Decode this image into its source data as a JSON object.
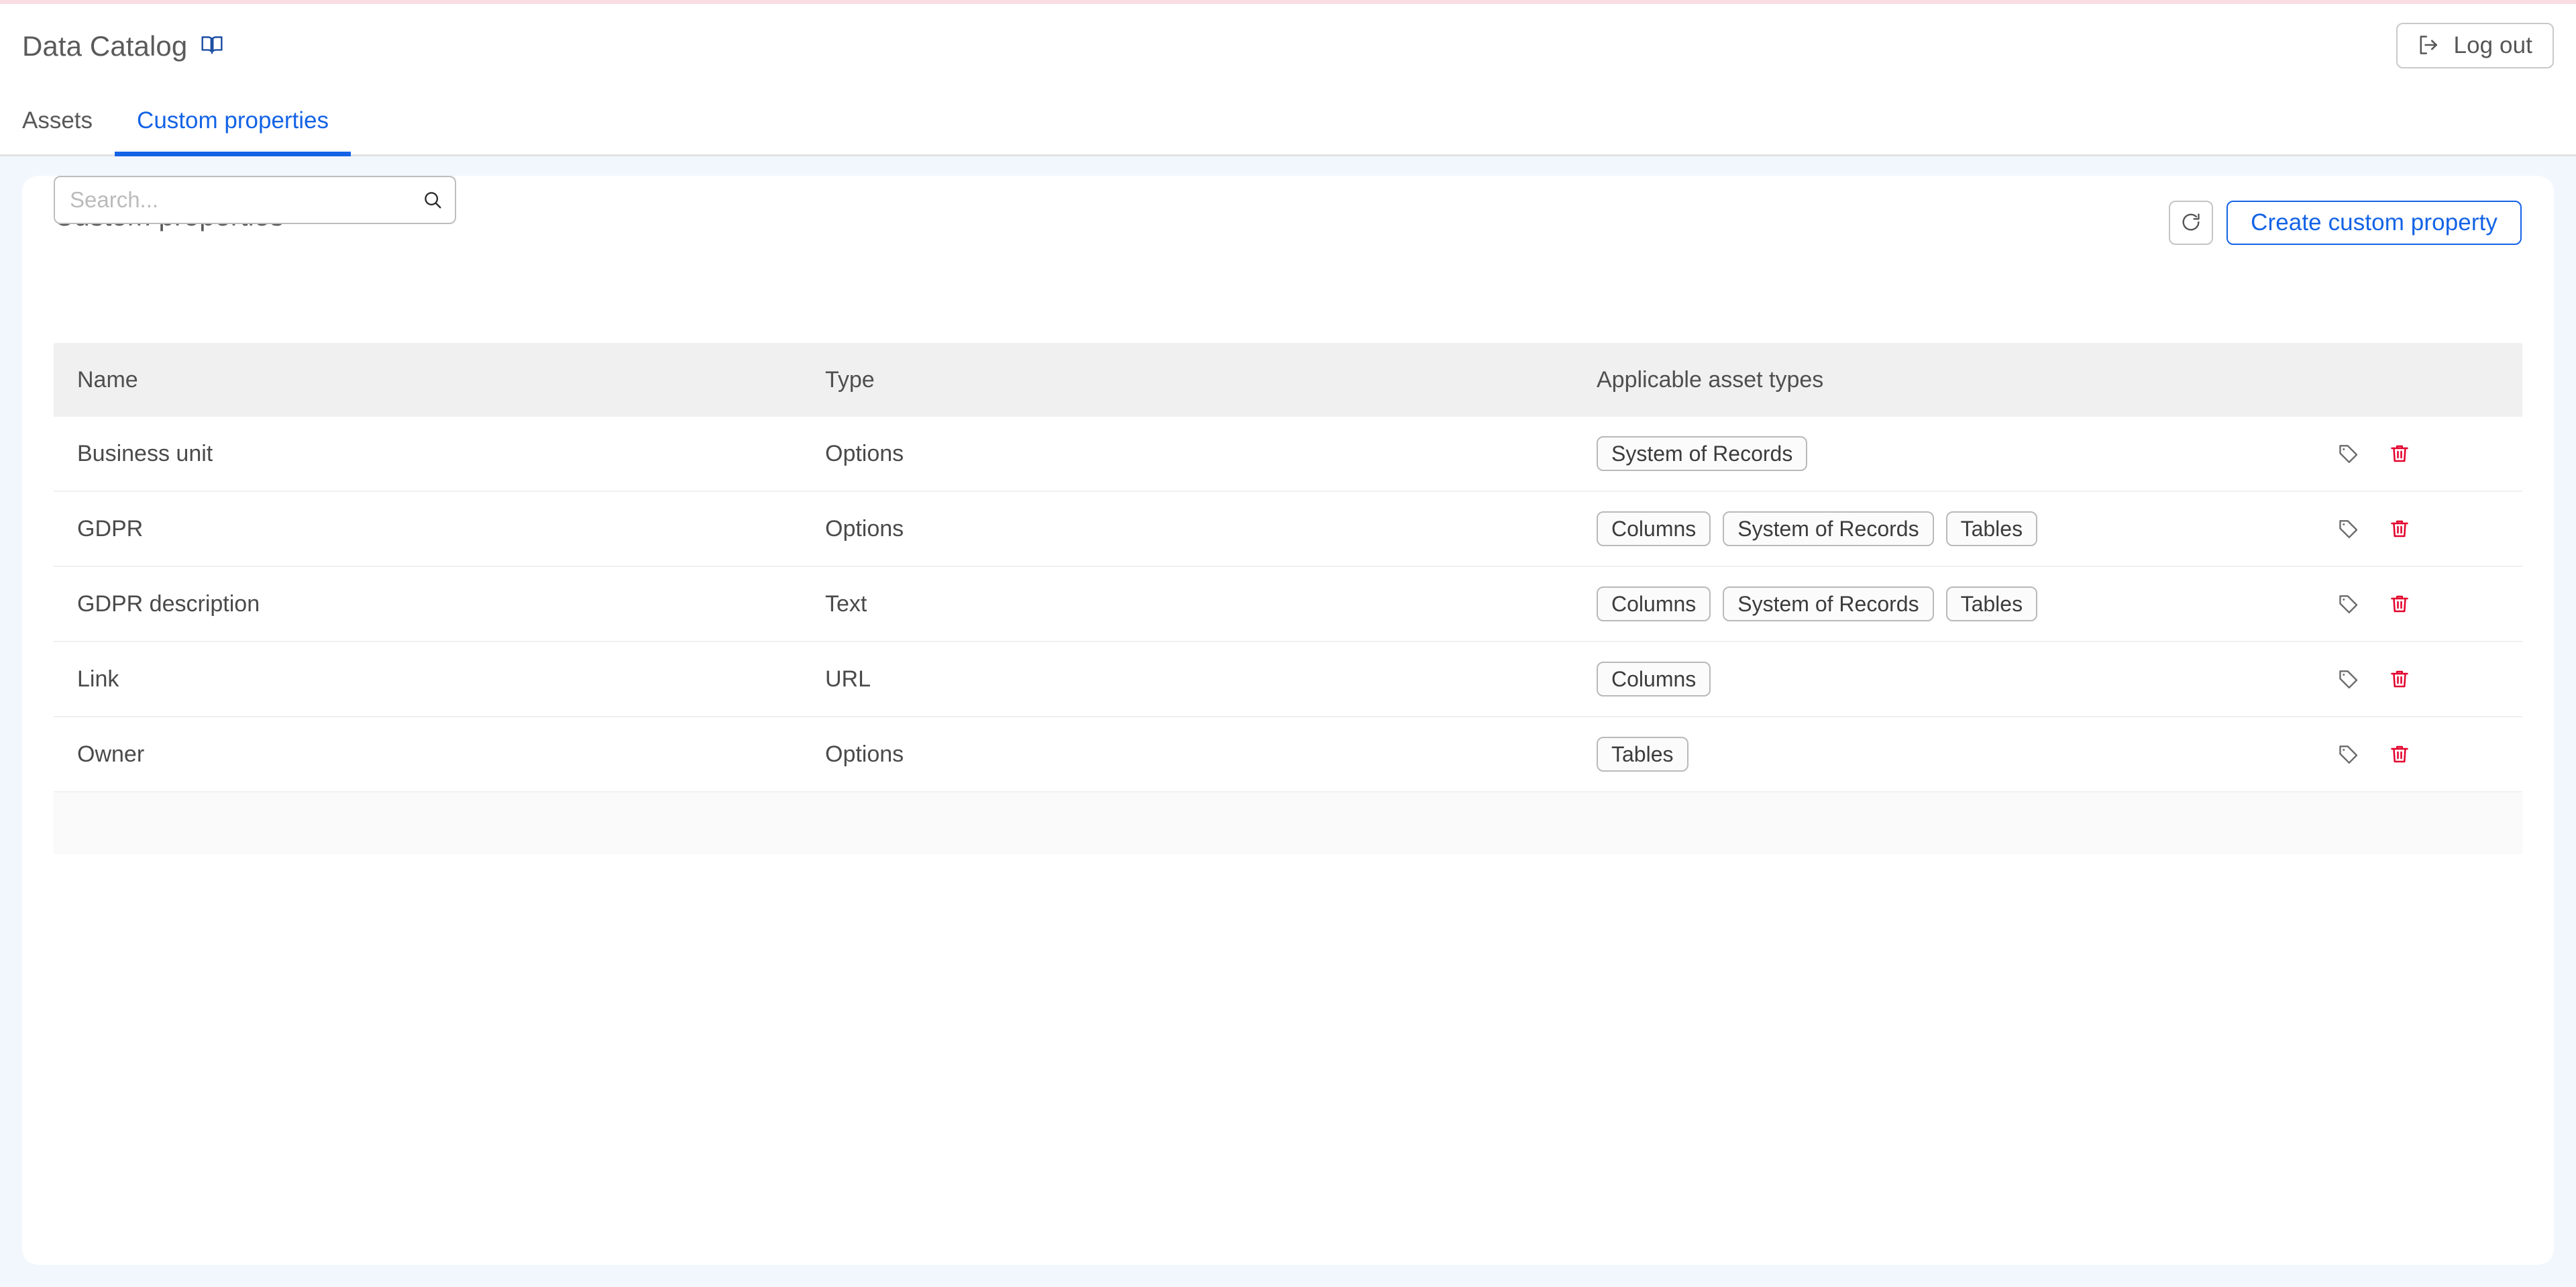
{
  "top_accent_color": "#f8dde3",
  "theme": {
    "accent_blue": "#1463e6",
    "page_background": "#f2f7fe",
    "danger_red": "#e4002b"
  },
  "header": {
    "app_title": "Data Catalog",
    "app_title_icon": "book-icon",
    "logout_label": "Log out",
    "logout_icon": "logout-icon"
  },
  "tabs": [
    {
      "label": "Assets",
      "active": false
    },
    {
      "label": "Custom properties",
      "active": true
    }
  ],
  "panel": {
    "title": "Custom properties",
    "title_icon": "book-icon",
    "refresh_icon": "refresh-icon",
    "create_label": "Create custom property"
  },
  "search": {
    "value": "",
    "placeholder": "Search...",
    "icon": "search-icon"
  },
  "table": {
    "columns": [
      "Name",
      "Type",
      "Applicable asset types"
    ],
    "rows": [
      {
        "name": "Business unit",
        "type": "Options",
        "asset_types": [
          "System of Records"
        ],
        "tag_icon": "tag-icon",
        "delete_icon": "trash-icon"
      },
      {
        "name": "GDPR",
        "type": "Options",
        "asset_types": [
          "Columns",
          "System of Records",
          "Tables"
        ],
        "tag_icon": "tag-icon",
        "delete_icon": "trash-icon"
      },
      {
        "name": "GDPR description",
        "type": "Text",
        "asset_types": [
          "Columns",
          "System of Records",
          "Tables"
        ],
        "tag_icon": "tag-icon",
        "delete_icon": "trash-icon"
      },
      {
        "name": "Link",
        "type": "URL",
        "asset_types": [
          "Columns"
        ],
        "tag_icon": "tag-icon",
        "delete_icon": "trash-icon"
      },
      {
        "name": "Owner",
        "type": "Options",
        "asset_types": [
          "Tables"
        ],
        "tag_icon": "tag-icon",
        "delete_icon": "trash-icon"
      }
    ]
  }
}
